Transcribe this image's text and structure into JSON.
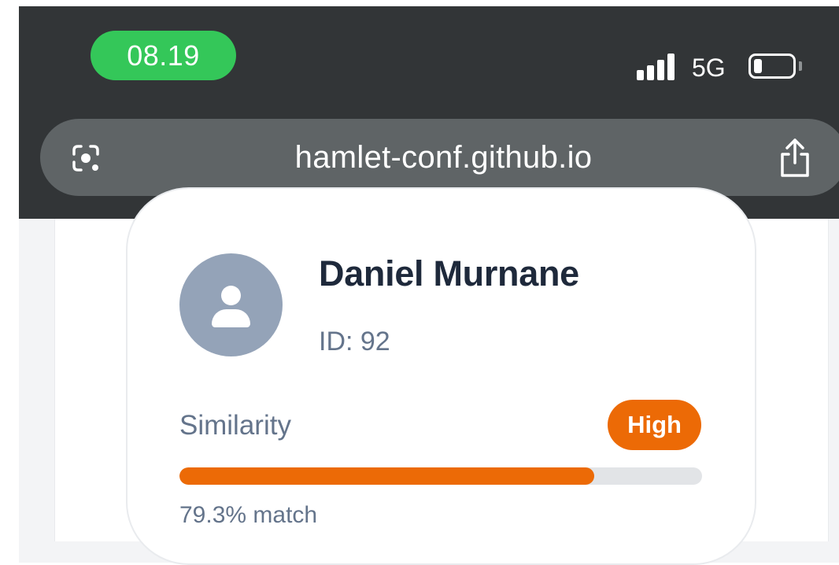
{
  "status_bar": {
    "time": "08.19",
    "network": "5G",
    "colors": {
      "time_pill": "#34c759",
      "chrome": "#323537"
    }
  },
  "browser": {
    "url": "hamlet-conf.github.io",
    "lens_icon": "google-lens-icon",
    "share_icon": "share-icon"
  },
  "profile": {
    "name": "Daniel Murnane",
    "id_label": "ID: 92",
    "avatar_icon": "person-icon",
    "similarity_label": "Similarity",
    "badge": "High",
    "match_text": "79.3% match",
    "match_fraction": 0.793,
    "accent_color": "#ec6a06"
  }
}
